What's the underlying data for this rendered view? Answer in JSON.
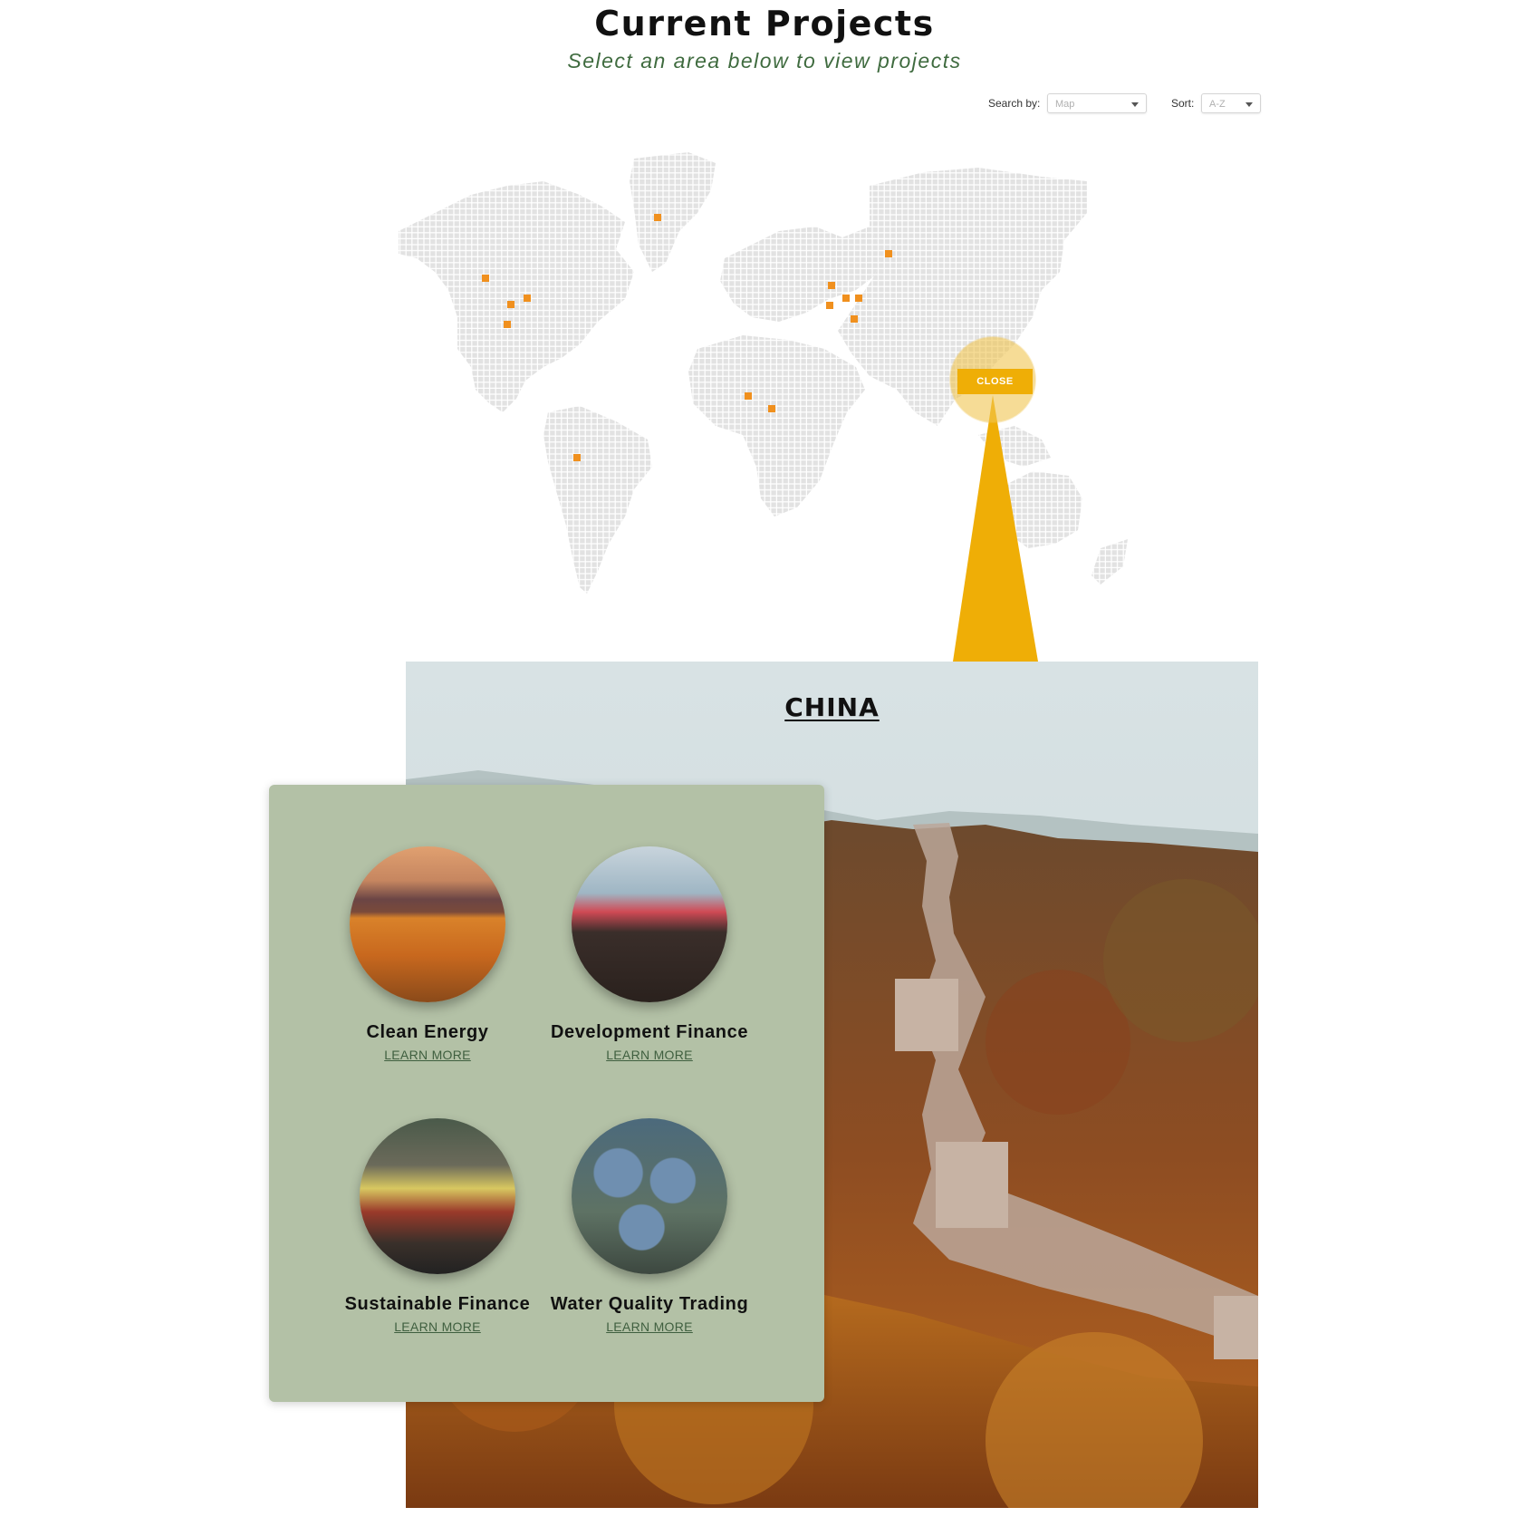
{
  "header": {
    "title": "Current Projects",
    "subtitle": "Select an area below to view projects"
  },
  "filters": {
    "search_label": "Search by:",
    "search_value": "Map",
    "sort_label": "Sort:",
    "sort_value": "A-Z"
  },
  "map": {
    "close_label": "CLOSE",
    "marker_color": "#f0901e",
    "land_color": "#e2e2e2",
    "pointer_color": "#efae06"
  },
  "panel": {
    "country": "CHINA",
    "card_color": "#b3c1a6",
    "projects": [
      {
        "name": "Clean Energy",
        "link": "LEARN MORE",
        "image": "solar-field-photo"
      },
      {
        "name": "Development Finance",
        "link": "LEARN MORE",
        "image": "street-crowd-photo"
      },
      {
        "name": "Sustainable Finance",
        "link": "LEARN MORE",
        "image": "protest-crowd-photo"
      },
      {
        "name": "Water Quality Trading",
        "link": "LEARN MORE",
        "image": "water-treatment-photo"
      }
    ]
  }
}
